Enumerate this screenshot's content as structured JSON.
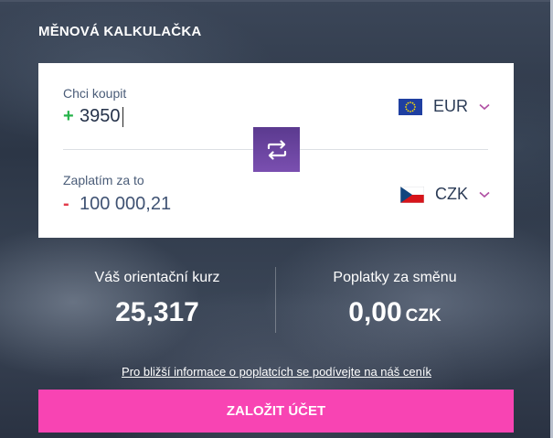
{
  "widget": {
    "title": "MĚNOVÁ KALKULAČKA"
  },
  "buy": {
    "label": "Chci koupit",
    "sign": "+",
    "amount": "3950",
    "currency": "EUR",
    "flag_icon": "eu-flag-icon"
  },
  "pay": {
    "label": "Zaplatím za to",
    "sign": "-",
    "amount": "100 000,21",
    "currency": "CZK",
    "flag_icon": "cz-flag-icon"
  },
  "swap": {
    "icon": "swap-arrows-icon"
  },
  "rate": {
    "label": "Váš orientační kurz",
    "value": "25,317"
  },
  "fees": {
    "label": "Poplatky za směnu",
    "value": "0,00",
    "unit": "CZK"
  },
  "fee_link": "Pro bližší informace o poplatcích se podívejte na náš ceník",
  "cta": {
    "label": "ZALOŽIT ÚČET"
  },
  "colors": {
    "accent_pink": "#f844b3",
    "swap_purple": "#6a45a0",
    "plus_green": "#26b34a",
    "minus_red": "#e23b4a",
    "label_text": "#4a5c78"
  }
}
